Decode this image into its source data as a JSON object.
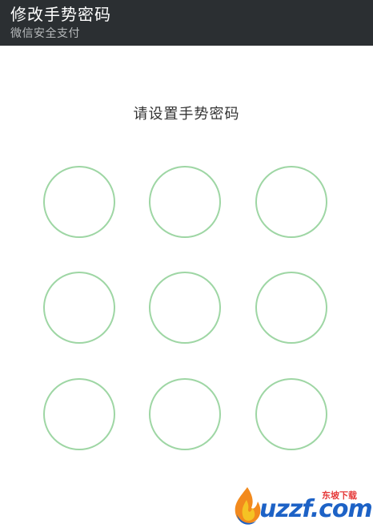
{
  "header": {
    "title": "修改手势密码",
    "subtitle": "微信安全支付"
  },
  "prompt": "请设置手势密码",
  "pattern": {
    "dot_count": 9,
    "ring_color": "#9ed6a4"
  },
  "watermark": {
    "brand": "uzzf.com",
    "tag": "东坡下载"
  },
  "colors": {
    "app_bar": "#2b2f32",
    "background": "#ffffff"
  }
}
